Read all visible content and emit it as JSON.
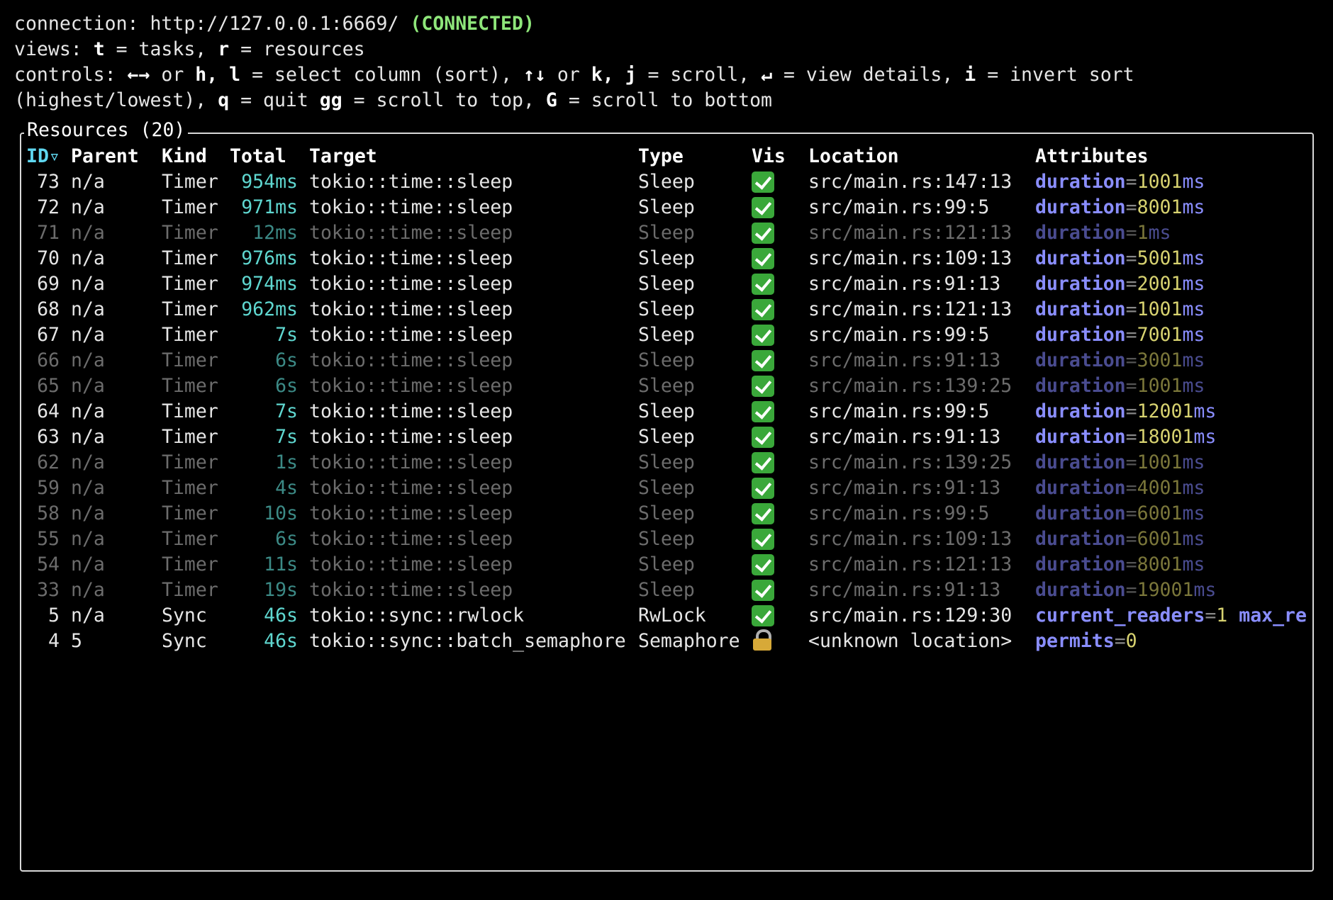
{
  "header": {
    "connection_prefix": "connection: http://127.0.0.1:6669/ ",
    "connection_status": "(CONNECTED)",
    "views_line": [
      {
        "t": "views: ",
        "b": false
      },
      {
        "t": "t",
        "b": true
      },
      {
        "t": " = tasks, ",
        "b": false
      },
      {
        "t": "r",
        "b": true
      },
      {
        "t": " = resources",
        "b": false
      }
    ],
    "controls_line1": [
      {
        "t": "controls: ",
        "b": false
      },
      {
        "t": "←→",
        "b": true
      },
      {
        "t": " or ",
        "b": false
      },
      {
        "t": "h, l",
        "b": true
      },
      {
        "t": " = select column (sort), ",
        "b": false
      },
      {
        "t": "↑↓",
        "b": true
      },
      {
        "t": " or ",
        "b": false
      },
      {
        "t": "k, j",
        "b": true
      },
      {
        "t": " = scroll, ",
        "b": false
      },
      {
        "t": "↵",
        "b": true
      },
      {
        "t": " = view details, ",
        "b": false
      },
      {
        "t": "i",
        "b": true
      },
      {
        "t": " = invert sort",
        "b": false
      }
    ],
    "controls_line2": [
      {
        "t": "(highest/lowest), ",
        "b": false
      },
      {
        "t": "q",
        "b": true
      },
      {
        "t": " = quit ",
        "b": false
      },
      {
        "t": "gg",
        "b": true
      },
      {
        "t": " = scroll to top, ",
        "b": false
      },
      {
        "t": "G",
        "b": true
      },
      {
        "t": " = scroll to bottom",
        "b": false
      }
    ]
  },
  "panel": {
    "title": "Resources (20)"
  },
  "table": {
    "columns": {
      "id": "ID▿",
      "parent": "Parent",
      "kind": "Kind",
      "total": "Total",
      "target": "Target",
      "type": "Type",
      "vis": "Vis",
      "location": "Location",
      "attributes": "Attributes"
    },
    "rows": [
      {
        "id": "73",
        "parent": "n/a",
        "kind": "Timer",
        "total": "954ms",
        "target": "tokio::time::sleep",
        "type": "Sleep",
        "vis": "check",
        "location": "src/main.rs:147:13",
        "attrs": [
          {
            "k": "duration",
            "v": "1001",
            "u": "ms"
          }
        ],
        "dim": false
      },
      {
        "id": "72",
        "parent": "n/a",
        "kind": "Timer",
        "total": "971ms",
        "target": "tokio::time::sleep",
        "type": "Sleep",
        "vis": "check",
        "location": "src/main.rs:99:5",
        "attrs": [
          {
            "k": "duration",
            "v": "8001",
            "u": "ms"
          }
        ],
        "dim": false
      },
      {
        "id": "71",
        "parent": "n/a",
        "kind": "Timer",
        "total": "12ms",
        "target": "tokio::time::sleep",
        "type": "Sleep",
        "vis": "check",
        "location": "src/main.rs:121:13",
        "attrs": [
          {
            "k": "duration",
            "v": "1",
            "u": "ms"
          }
        ],
        "dim": true
      },
      {
        "id": "70",
        "parent": "n/a",
        "kind": "Timer",
        "total": "976ms",
        "target": "tokio::time::sleep",
        "type": "Sleep",
        "vis": "check",
        "location": "src/main.rs:109:13",
        "attrs": [
          {
            "k": "duration",
            "v": "5001",
            "u": "ms"
          }
        ],
        "dim": false
      },
      {
        "id": "69",
        "parent": "n/a",
        "kind": "Timer",
        "total": "974ms",
        "target": "tokio::time::sleep",
        "type": "Sleep",
        "vis": "check",
        "location": "src/main.rs:91:13",
        "attrs": [
          {
            "k": "duration",
            "v": "2001",
            "u": "ms"
          }
        ],
        "dim": false
      },
      {
        "id": "68",
        "parent": "n/a",
        "kind": "Timer",
        "total": "962ms",
        "target": "tokio::time::sleep",
        "type": "Sleep",
        "vis": "check",
        "location": "src/main.rs:121:13",
        "attrs": [
          {
            "k": "duration",
            "v": "1001",
            "u": "ms"
          }
        ],
        "dim": false
      },
      {
        "id": "67",
        "parent": "n/a",
        "kind": "Timer",
        "total": "7s",
        "target": "tokio::time::sleep",
        "type": "Sleep",
        "vis": "check",
        "location": "src/main.rs:99:5",
        "attrs": [
          {
            "k": "duration",
            "v": "7001",
            "u": "ms"
          }
        ],
        "dim": false
      },
      {
        "id": "66",
        "parent": "n/a",
        "kind": "Timer",
        "total": "6s",
        "target": "tokio::time::sleep",
        "type": "Sleep",
        "vis": "check",
        "location": "src/main.rs:91:13",
        "attrs": [
          {
            "k": "duration",
            "v": "3001",
            "u": "ms"
          }
        ],
        "dim": true
      },
      {
        "id": "65",
        "parent": "n/a",
        "kind": "Timer",
        "total": "6s",
        "target": "tokio::time::sleep",
        "type": "Sleep",
        "vis": "check",
        "location": "src/main.rs:139:25",
        "attrs": [
          {
            "k": "duration",
            "v": "1001",
            "u": "ms"
          }
        ],
        "dim": true
      },
      {
        "id": "64",
        "parent": "n/a",
        "kind": "Timer",
        "total": "7s",
        "target": "tokio::time::sleep",
        "type": "Sleep",
        "vis": "check",
        "location": "src/main.rs:99:5",
        "attrs": [
          {
            "k": "duration",
            "v": "12001",
            "u": "ms"
          }
        ],
        "dim": false
      },
      {
        "id": "63",
        "parent": "n/a",
        "kind": "Timer",
        "total": "7s",
        "target": "tokio::time::sleep",
        "type": "Sleep",
        "vis": "check",
        "location": "src/main.rs:91:13",
        "attrs": [
          {
            "k": "duration",
            "v": "18001",
            "u": "ms"
          }
        ],
        "dim": false
      },
      {
        "id": "62",
        "parent": "n/a",
        "kind": "Timer",
        "total": "1s",
        "target": "tokio::time::sleep",
        "type": "Sleep",
        "vis": "check",
        "location": "src/main.rs:139:25",
        "attrs": [
          {
            "k": "duration",
            "v": "1001",
            "u": "ms"
          }
        ],
        "dim": true
      },
      {
        "id": "59",
        "parent": "n/a",
        "kind": "Timer",
        "total": "4s",
        "target": "tokio::time::sleep",
        "type": "Sleep",
        "vis": "check",
        "location": "src/main.rs:91:13",
        "attrs": [
          {
            "k": "duration",
            "v": "4001",
            "u": "ms"
          }
        ],
        "dim": true
      },
      {
        "id": "58",
        "parent": "n/a",
        "kind": "Timer",
        "total": "10s",
        "target": "tokio::time::sleep",
        "type": "Sleep",
        "vis": "check",
        "location": "src/main.rs:99:5",
        "attrs": [
          {
            "k": "duration",
            "v": "6001",
            "u": "ms"
          }
        ],
        "dim": true
      },
      {
        "id": "55",
        "parent": "n/a",
        "kind": "Timer",
        "total": "6s",
        "target": "tokio::time::sleep",
        "type": "Sleep",
        "vis": "check",
        "location": "src/main.rs:109:13",
        "attrs": [
          {
            "k": "duration",
            "v": "6001",
            "u": "ms"
          }
        ],
        "dim": true
      },
      {
        "id": "54",
        "parent": "n/a",
        "kind": "Timer",
        "total": "11s",
        "target": "tokio::time::sleep",
        "type": "Sleep",
        "vis": "check",
        "location": "src/main.rs:121:13",
        "attrs": [
          {
            "k": "duration",
            "v": "8001",
            "u": "ms"
          }
        ],
        "dim": true
      },
      {
        "id": "33",
        "parent": "n/a",
        "kind": "Timer",
        "total": "19s",
        "target": "tokio::time::sleep",
        "type": "Sleep",
        "vis": "check",
        "location": "src/main.rs:91:13",
        "attrs": [
          {
            "k": "duration",
            "v": "19001",
            "u": "ms"
          }
        ],
        "dim": true
      },
      {
        "id": "5",
        "parent": "n/a",
        "kind": "Sync",
        "total": "46s",
        "target": "tokio::sync::rwlock",
        "type": "RwLock",
        "vis": "check",
        "location": "src/main.rs:129:30",
        "attrs": [
          {
            "k": "current_readers",
            "v": "1",
            "u": ""
          },
          {
            "k": "max_re",
            "v": "",
            "u": "",
            "eq": false
          }
        ],
        "dim": false
      },
      {
        "id": "4",
        "parent": "5",
        "kind": "Sync",
        "total": "46s",
        "target": "tokio::sync::batch_semaphore",
        "type": "Semaphore",
        "vis": "lock",
        "location": "<unknown location>",
        "attrs": [
          {
            "k": "permits",
            "v": "0",
            "u": ""
          }
        ],
        "dim": false
      }
    ]
  },
  "colors": {
    "background": "#000000",
    "connected": "#8ee67a",
    "active_header": "#5fd7f0",
    "total": "#5fd7d0",
    "attr_key": "#8a8eff",
    "attr_value": "#d7d270",
    "visible_check": "#3aa83a",
    "lock": "#d7a938"
  },
  "icons": {
    "check": "check-mark-icon",
    "lock": "lock-icon"
  }
}
